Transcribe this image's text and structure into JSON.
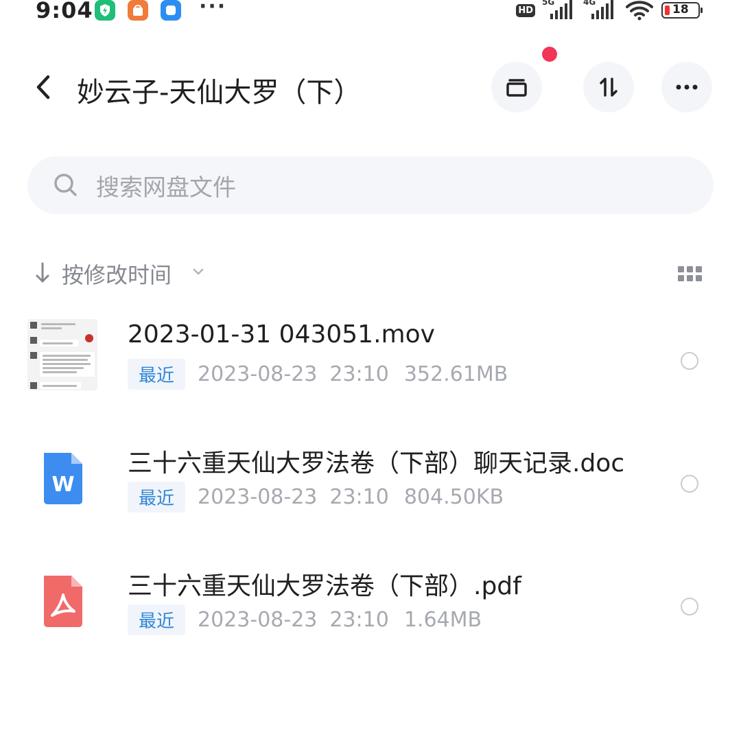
{
  "status_bar": {
    "time": "9:04",
    "more": "···",
    "hd": "HD",
    "net1": "5G",
    "net2": "4G",
    "battery": "18"
  },
  "header": {
    "title": "妙云子-天仙大罗（下）"
  },
  "search": {
    "placeholder": "搜索网盘文件"
  },
  "sort": {
    "label": "按修改时间"
  },
  "files": [
    {
      "name": "2023-01-31 043051.mov",
      "tag": "最近",
      "date": "2023-08-23",
      "time": "23:10",
      "size": "352.61MB",
      "icon": "video-thumbnail"
    },
    {
      "name": "三十六重天仙大罗法卷（下部）聊天记录.doc",
      "tag": "最近",
      "date": "2023-08-23",
      "time": "23:10",
      "size": "804.50KB",
      "icon": "word-doc-icon",
      "icon_letter": "W"
    },
    {
      "name": "三十六重天仙大罗法卷（下部）.pdf",
      "tag": "最近",
      "date": "2023-08-23",
      "time": "23:10",
      "size": "1.64MB",
      "icon": "pdf-icon"
    }
  ],
  "colors": {
    "accent_blue": "#2f86d6",
    "word_blue": "#3d8df0",
    "pdf_red": "#f06a6a",
    "notification_red": "#f2365a"
  }
}
